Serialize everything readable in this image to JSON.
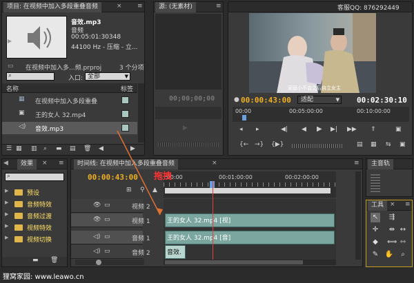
{
  "watermark": {
    "qq": "客服QQ: 876292449",
    "site": "狸窝家园: www.leawo.cn"
  },
  "project": {
    "tab": "项目: 在视频中加入多段重叠音频",
    "clip_name": "音效.mp3",
    "clip_type": "音频",
    "clip_duration": "00:05:01:30348",
    "clip_format": "44100 Hz - 压缩 - 立...",
    "file_name": "在视频中加入多...频.prproj",
    "item_count": "3 个分项",
    "in_label": "入口:",
    "in_value": "全部",
    "col_name": "名称",
    "col_label": "标签",
    "items": [
      {
        "name": "在视频中加入多段重叠",
        "icon": "sequence-icon"
      },
      {
        "name": "王的女人 32.mp4",
        "icon": "video-icon"
      },
      {
        "name": "音效.mp3",
        "icon": "audio-icon"
      }
    ]
  },
  "source": {
    "tab": "源: (无素材)",
    "timecode": "00;00;00;00"
  },
  "program": {
    "subtitle": "家庭小不会之后自立女主",
    "timecode_in": "00:00:43:00",
    "fit": "适配",
    "timecode_out": "00:02:30:10",
    "ruler": [
      "00:00",
      "00:05:00:00",
      "00:10:00:00"
    ]
  },
  "effects": {
    "tab": "效果",
    "folders": [
      "预设",
      "音频特效",
      "音频过渡",
      "视频特效",
      "视频切换"
    ]
  },
  "timeline": {
    "tab": "时间线: 在视频中加入多段重叠音频",
    "timecode": "00:00:43:00",
    "ruler": [
      ":00:00",
      "00:01:00:00",
      "00:02:00:00"
    ],
    "drag_label": "拖拽",
    "tracks": [
      {
        "name": "视频 2",
        "kind": "video"
      },
      {
        "name": "视频 1",
        "kind": "video"
      },
      {
        "name": "音频 1",
        "kind": "audio"
      },
      {
        "name": "音频 2",
        "kind": "audio"
      }
    ],
    "clips": {
      "video1": "王的女人 32.mp4 [视]",
      "audio1": "王的女人 32.mp4 [音]",
      "audio2": "音效."
    }
  },
  "master": {
    "tab": "主音轨"
  },
  "tools": {
    "tab": "工具"
  },
  "colors": {
    "timecode": "#f0b020",
    "clip_video": "#7aa69f",
    "clip_audio": "#7aa69f",
    "playhead": "#e04040",
    "drag_arrow": "#e07030"
  }
}
